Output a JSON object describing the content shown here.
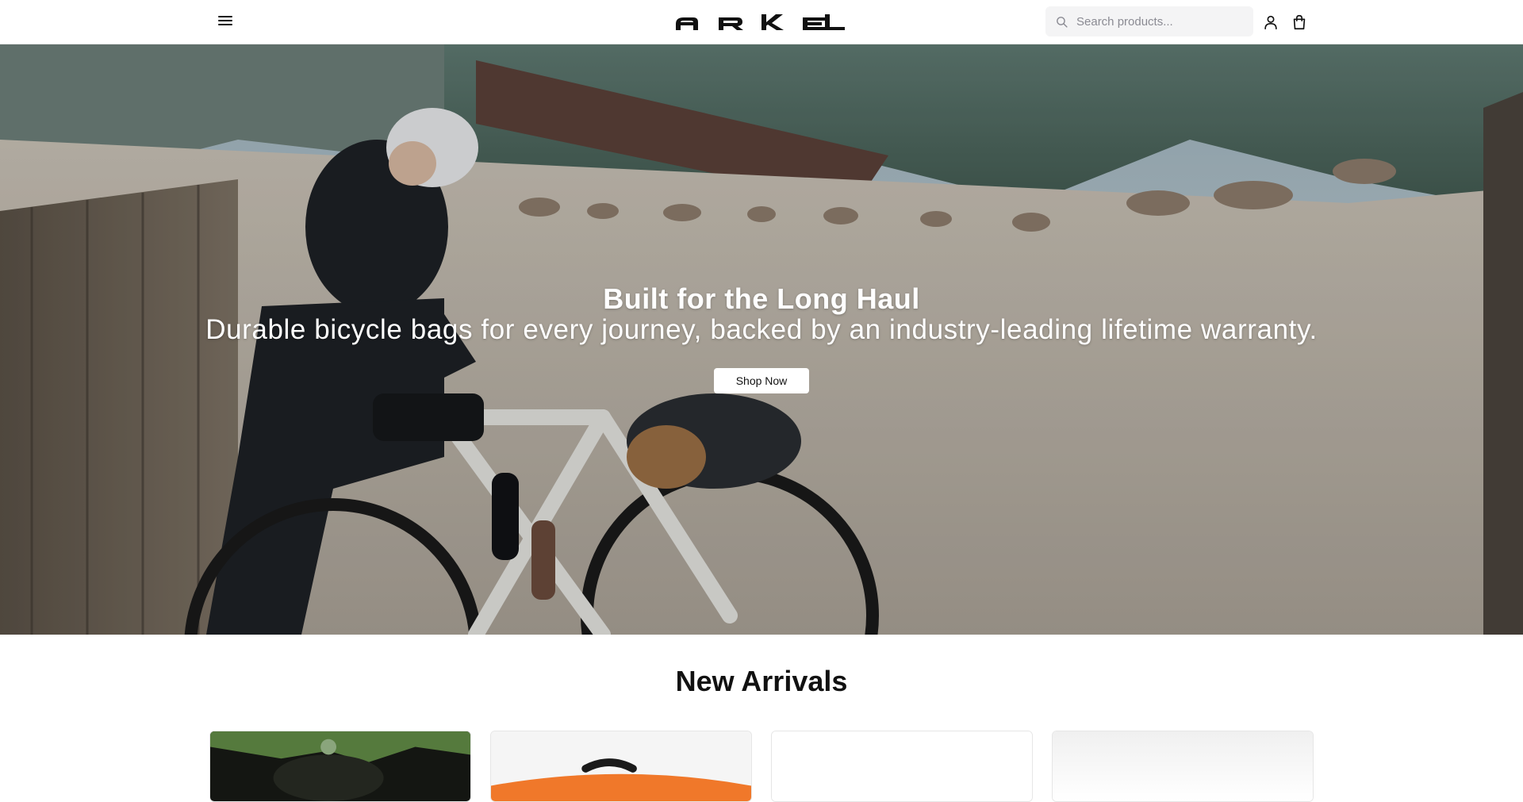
{
  "header": {
    "brand": "ARKEL",
    "search_placeholder": "Search products...",
    "icons": [
      "menu-icon",
      "search-icon",
      "user-icon",
      "shopping-bag-icon"
    ]
  },
  "hero": {
    "title": "Built for the Long Haul",
    "subtitle": "Durable bicycle bags for every journey, backed by an industry-leading lifetime warranty.",
    "cta_label": "Shop Now"
  },
  "new_arrivals": {
    "title": "New Arrivals",
    "products": [
      {
        "image": "product-image"
      },
      {
        "image": "product-image"
      },
      {
        "image": "product-image"
      },
      {
        "image": "product-image"
      }
    ]
  },
  "colors": {
    "header_bg": "#ffffff",
    "cta_bg": "#ffffff",
    "text": "#111111",
    "accent_orange": "#f0782a"
  }
}
